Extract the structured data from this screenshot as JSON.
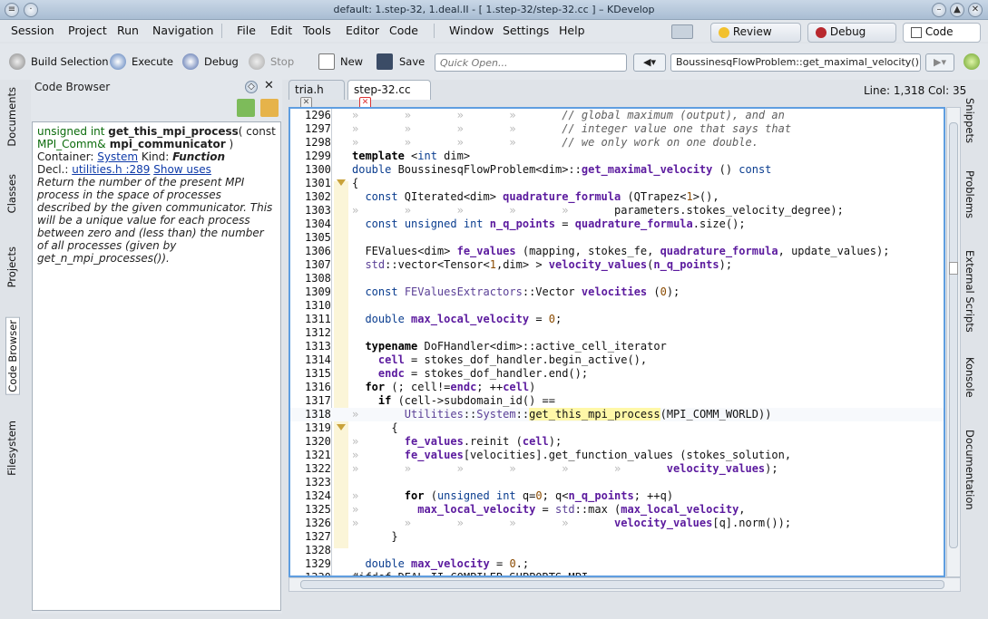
{
  "window": {
    "title": "default:  1.step-32, 1.deal.II - [ 1.step-32/step-32.cc ] – KDevelop"
  },
  "menu": [
    "Session",
    "Project",
    "Run",
    "Navigation",
    "File",
    "Edit",
    "Tools",
    "Editor",
    "Code",
    "Window",
    "Settings",
    "Help"
  ],
  "areas": {
    "review": "Review",
    "debug": "Debug",
    "code": "Code"
  },
  "toolbar": {
    "build": "Build Selection",
    "execute": "Execute",
    "debug": "Debug",
    "stop": "Stop",
    "new": "New",
    "save": "Save",
    "quick_open_placeholder": "Quick Open...",
    "context": "BoussinesqFlowProblem::get_maximal_velocity()"
  },
  "left_tabs": [
    "Documents",
    "Classes",
    "Projects",
    "Code Browser",
    "Filesystem"
  ],
  "right_tabs": [
    "Snippets",
    "Problems",
    "External Scripts",
    "Konsole",
    "Documentation"
  ],
  "code_browser": {
    "title": "Code Browser",
    "sig_prefix": "unsigned int ",
    "sig_name": "get_this_mpi_process",
    "sig_paren": "( const",
    "sig_type": "MPI_Comm&",
    "sig_param": " mpi_communicator",
    "sig_close": " )",
    "container_label": "Container: ",
    "container_link": "System",
    "kind_label": " Kind: ",
    "kind": "Function",
    "decl_label": "Decl.: ",
    "decl_link": "utilities.h :289",
    "show_uses": "Show uses",
    "doc": "Return the number of the present MPI process in the space of processes described by the given communicator. This will be a unique value for each process between zero and (less than) the number of all processes (given by get_n_mpi_processes())."
  },
  "editor_tabs": [
    "tria.h",
    "step-32.cc"
  ],
  "status": "Line: 1,318 Col: 35",
  "code_lines": [
    {
      "n": "1296",
      "t": "// global maximum (output), and an",
      "c": "cm",
      "ind": "»       »       »       »       "
    },
    {
      "n": "1297",
      "t": "// integer value one that says that",
      "c": "cm",
      "ind": "»       »       »       »       "
    },
    {
      "n": "1298",
      "t": "// we only work on one double.",
      "c": "cm",
      "ind": "»       »       »       »       "
    },
    {
      "n": "1299",
      "t": "template <int dim>",
      "c": "",
      "ind": ""
    },
    {
      "n": "1300",
      "t": "double BoussinesqFlowProblem<dim>::get_maximal_velocity () const",
      "c": "",
      "ind": ""
    },
    {
      "n": "1301",
      "t": "{",
      "c": "",
      "ind": ""
    },
    {
      "n": "1302",
      "t": "  const QIterated<dim> quadrature_formula (QTrapez<1>(),",
      "c": "",
      "ind": ""
    },
    {
      "n": "1303",
      "t": "parameters.stokes_velocity_degree);",
      "c": "",
      "ind": "»       »       »       »       »       "
    },
    {
      "n": "1304",
      "t": "  const unsigned int n_q_points = quadrature_formula.size();",
      "c": "",
      "ind": ""
    },
    {
      "n": "1305",
      "t": "",
      "c": "",
      "ind": ""
    },
    {
      "n": "1306",
      "t": "  FEValues<dim> fe_values (mapping, stokes_fe, quadrature_formula, update_values);",
      "c": "",
      "ind": ""
    },
    {
      "n": "1307",
      "t": "  std::vector<Tensor<1,dim> > velocity_values(n_q_points);",
      "c": "",
      "ind": ""
    },
    {
      "n": "1308",
      "t": "",
      "c": "",
      "ind": ""
    },
    {
      "n": "1309",
      "t": "  const FEValuesExtractors::Vector velocities (0);",
      "c": "",
      "ind": ""
    },
    {
      "n": "1310",
      "t": "",
      "c": "",
      "ind": ""
    },
    {
      "n": "1311",
      "t": "  double max_local_velocity = 0;",
      "c": "",
      "ind": ""
    },
    {
      "n": "1312",
      "t": "",
      "c": "",
      "ind": ""
    },
    {
      "n": "1313",
      "t": "  typename DoFHandler<dim>::active_cell_iterator",
      "c": "",
      "ind": ""
    },
    {
      "n": "1314",
      "t": "    cell = stokes_dof_handler.begin_active(),",
      "c": "",
      "ind": ""
    },
    {
      "n": "1315",
      "t": "    endc = stokes_dof_handler.end();",
      "c": "",
      "ind": ""
    },
    {
      "n": "1316",
      "t": "  for (; cell!=endc; ++cell)",
      "c": "",
      "ind": ""
    },
    {
      "n": "1317",
      "t": "    if (cell->subdomain_id() ==",
      "c": "",
      "ind": ""
    },
    {
      "n": "1318",
      "t": "Utilities::System::get_this_mpi_process(MPI_COMM_WORLD))",
      "c": "",
      "ind": "»       "
    },
    {
      "n": "1319",
      "t": "      {",
      "c": "",
      "ind": ""
    },
    {
      "n": "1320",
      "t": "fe_values.reinit (cell);",
      "c": "",
      "ind": "»       "
    },
    {
      "n": "1321",
      "t": "fe_values[velocities].get_function_values (stokes_solution,",
      "c": "",
      "ind": "»       "
    },
    {
      "n": "1322",
      "t": "velocity_values);",
      "c": "",
      "ind": "»       »       »       »       »       »       "
    },
    {
      "n": "1323",
      "t": "",
      "c": "",
      "ind": ""
    },
    {
      "n": "1324",
      "t": "for (unsigned int q=0; q<n_q_points; ++q)",
      "c": "",
      "ind": "»       "
    },
    {
      "n": "1325",
      "t": "  max_local_velocity = std::max (max_local_velocity,",
      "c": "",
      "ind": "»       "
    },
    {
      "n": "1326",
      "t": "velocity_values[q].norm());",
      "c": "",
      "ind": "»       »       »       »       »       "
    },
    {
      "n": "1327",
      "t": "      }",
      "c": "",
      "ind": ""
    },
    {
      "n": "1328",
      "t": "",
      "c": "",
      "ind": ""
    },
    {
      "n": "1329",
      "t": "  double max_velocity = 0.;",
      "c": "",
      "ind": ""
    },
    {
      "n": "1330",
      "t": "#ifdef DEAL_II_COMPILER_SUPPORTS_MPI",
      "c": "",
      "ind": ""
    }
  ]
}
